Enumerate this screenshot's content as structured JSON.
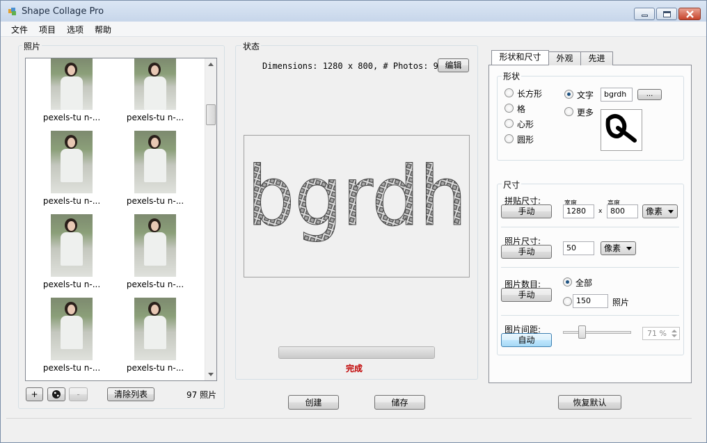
{
  "window": {
    "title": "Shape Collage Pro"
  },
  "menu": [
    "文件",
    "项目",
    "选项",
    "帮助"
  ],
  "photos": {
    "group_label": "照片",
    "items": [
      {
        "label": "pexels-tu n-..."
      },
      {
        "label": "pexels-tu n-..."
      },
      {
        "label": "pexels-tu n-..."
      },
      {
        "label": "pexels-tu n-..."
      },
      {
        "label": "pexels-tu n-..."
      },
      {
        "label": "pexels-tu n-..."
      },
      {
        "label": "pexels-tu n-..."
      },
      {
        "label": "pexels-tu n-..."
      }
    ],
    "add_label": "+",
    "remove_label": "-",
    "clear_label": "清除列表",
    "count_text": "97 照片"
  },
  "status": {
    "group_label": "状态",
    "info_text": "Dimensions: 1280 x 800, # Photos: 97",
    "edit_label": "编辑",
    "preview_text": "bgrdh",
    "progress": 1.0,
    "done_text": "完成",
    "done_color": "#c00000"
  },
  "bottom": {
    "create_label": "创建",
    "save_label": "储存",
    "reset_label": "恢复默认"
  },
  "tabs": [
    {
      "label": "形状和尺寸"
    },
    {
      "label": "外观"
    },
    {
      "label": "先进"
    }
  ],
  "shape": {
    "group_label": "形状",
    "options": [
      "长方形",
      "格",
      "心形",
      "圆形"
    ],
    "text_label": "文字",
    "text_value": "bgrdh",
    "more_label": "更多",
    "ellipsis_label": "..."
  },
  "size": {
    "group_label": "尺寸",
    "collage_label": "拼贴尺寸:",
    "collage_button": "手动",
    "width_label": "宽度",
    "height_label": "高度",
    "width_value": "1280",
    "x_label": "x",
    "height_value": "800",
    "unit": "像素",
    "photo_label": "照片尺寸:",
    "photo_button": "手动",
    "photo_value": "50",
    "photo_unit": "像素",
    "count_label": "图片数目:",
    "count_button": "手动",
    "all_label": "全部",
    "count_value": "150",
    "count_unit": "照片",
    "spacing_label": "图片间距:",
    "spacing_button": "自动",
    "spacing_value": "71 %"
  }
}
